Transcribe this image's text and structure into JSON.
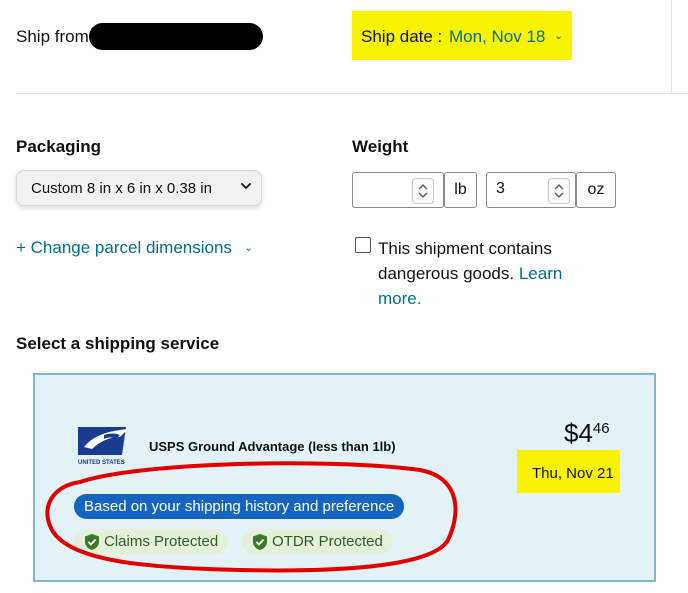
{
  "header": {
    "ship_from_label": "Ship from",
    "ship_date_label": "Ship date :",
    "ship_date_value": "Mon, Nov 18",
    "ship_date_caret": "⌄"
  },
  "packaging": {
    "title": "Packaging",
    "selected": "Custom 8 in x 6 in x 0.38 in"
  },
  "weight": {
    "title": "Weight",
    "lb_value": "",
    "lb_unit": "lb",
    "oz_value": "3",
    "oz_unit": "oz"
  },
  "change_dimensions": {
    "label": "+ Change parcel dimensions",
    "caret": "⌄"
  },
  "dangerous_goods": {
    "text": "This shipment contains dangerous goods.",
    "link": "Learn more.",
    "checked": false
  },
  "service_section": {
    "title": "Select a shipping service"
  },
  "service": {
    "name": "USPS Ground Advantage (less than 1lb)",
    "price_dollars": "$4",
    "price_cents": "46",
    "delivery_date": "Thu, Nov 21",
    "recommendation": "Based on your shipping history and preference",
    "badges": [
      "Claims Protected",
      "OTDR Protected"
    ],
    "logo_icon": "usps-eagle-icon",
    "logo_text": "UNITED STATES"
  },
  "colors": {
    "link": "#007185",
    "highlight": "#f9f200",
    "card_bg": "#e3f2f6",
    "reco_badge": "#1564c0",
    "protect_badge": "#e5f0da",
    "annotation": "#e00000"
  }
}
